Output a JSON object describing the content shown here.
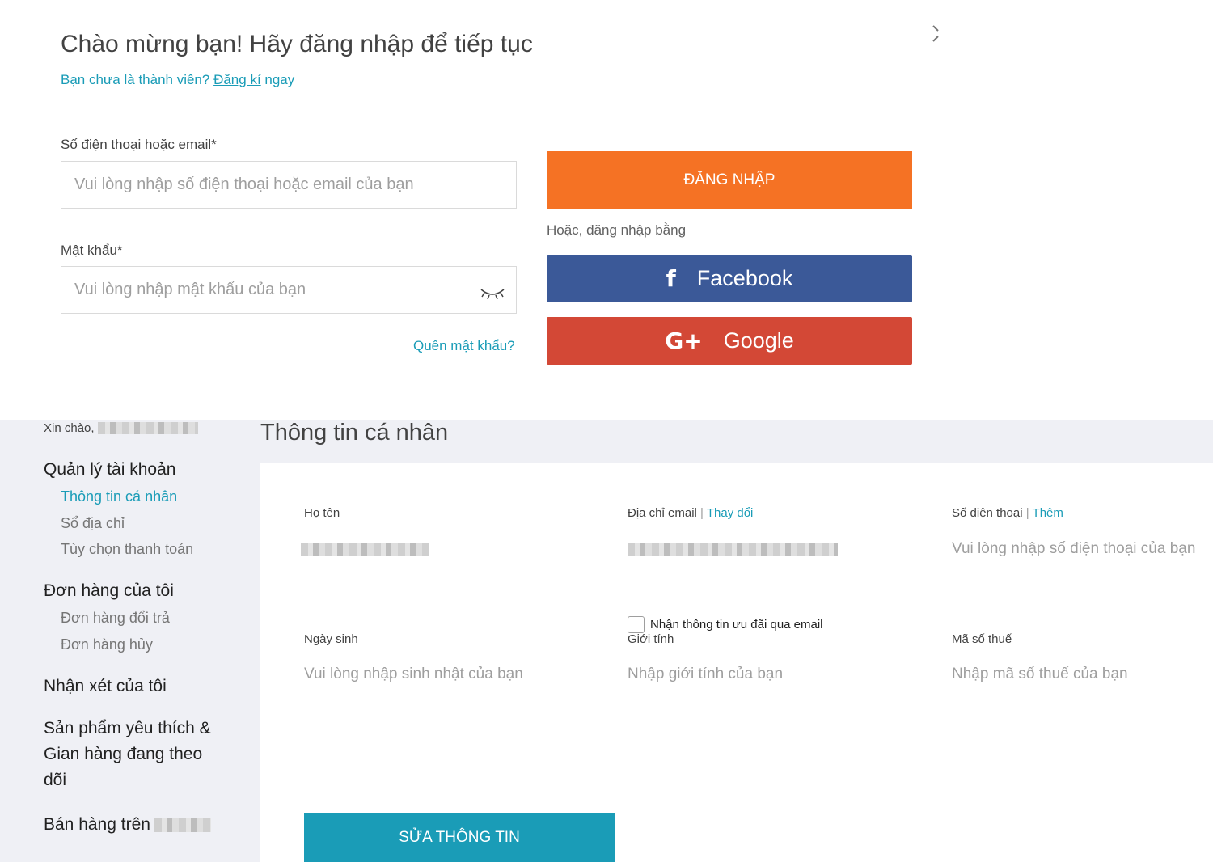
{
  "login": {
    "title": "Chào mừng bạn! Hãy đăng nhập để tiếp tục",
    "subtitle_prefix": "Bạn chưa là thành viên? ",
    "register_link": "Đăng kí",
    "subtitle_suffix": " ngay",
    "phone_email_label": "Số điện thoại hoặc email*",
    "phone_email_placeholder": "Vui lòng nhập số điện thoại hoặc email của bạn",
    "password_label": "Mật khẩu*",
    "password_placeholder": "Vui lòng nhập mật khẩu của bạn",
    "forgot_password": "Quên mật khẩu?",
    "login_button": "ĐĂNG NHẬP",
    "or_text": "Hoặc, đăng nhập bằng",
    "facebook_icon": "f",
    "facebook_label": "Facebook",
    "google_icon": "G+",
    "google_label": "Google",
    "colors": {
      "login_button": "#f57224",
      "facebook": "#3b5998",
      "google": "#d34836",
      "link": "#1a9cb7"
    }
  },
  "sidebar": {
    "greeting": "Xin chào,",
    "account_mgmt": "Quản lý tài khoản",
    "personal_info": "Thông tin cá nhân",
    "address_book": "Sổ địa chỉ",
    "payment_options": "Tùy chọn thanh toán",
    "my_orders": "Đơn hàng của tôi",
    "returns": "Đơn hàng đổi trả",
    "cancellations": "Đơn hàng hủy",
    "my_reviews": "Nhận xét của tôi",
    "wishlist": "Sản phẩm yêu thích & Gian hàng đang theo dõi",
    "sell_on": "Bán hàng trên"
  },
  "profile": {
    "page_title": "Thông tin cá nhân",
    "name_label": "Họ tên",
    "email_label": "Địa chỉ email",
    "email_change": "Thay đổi",
    "phone_label": "Số điện thoại",
    "phone_add": "Thêm",
    "phone_placeholder": "Vui lòng nhập số điện thoại của bạn",
    "subscribe_label": "Nhận thông tin ưu đãi qua email",
    "birthday_label": "Ngày sinh",
    "birthday_placeholder": "Vui lòng nhập sinh nhật của bạn",
    "gender_label": "Giới tính",
    "gender_placeholder": "Nhập giới tính của bạn",
    "tax_label": "Mã số thuế",
    "tax_placeholder": "Nhập mã số thuế của bạn",
    "edit_button": "SỬA THÔNG TIN",
    "sep": " | "
  }
}
